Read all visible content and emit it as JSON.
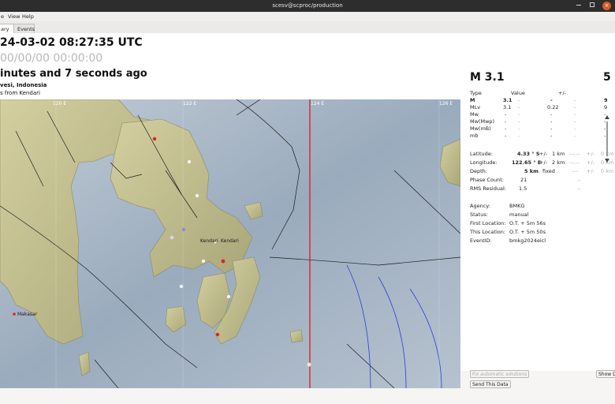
{
  "window": {
    "title": "scesv@scproc/production"
  },
  "menu": {
    "file": "e",
    "view": "View",
    "help": "Help"
  },
  "tabs": [
    {
      "label": "ary"
    },
    {
      "label": "Events"
    }
  ],
  "event": {
    "time": "24-03-02 08:27:35 UTC",
    "sub_time": "00/00/00  00:00:00",
    "ago": "inutes and 7 seconds ago",
    "region": "vesi, Indonesia",
    "distance": "s from Kendari"
  },
  "map": {
    "lon_labels": [
      "120 E",
      "122 E",
      "124 E",
      "126 E"
    ],
    "places": [
      "Kendari",
      "Kendari",
      "Makasar"
    ],
    "colors": {
      "sea": "#a8b6c5",
      "land": "#c7c48f",
      "epicenter_line": "#e01010"
    }
  },
  "magnitude": {
    "title": "M 3.1",
    "headers": {
      "type": "Type",
      "value": "Value",
      "pm": "+/-"
    },
    "rows": [
      {
        "type": "M",
        "value": "3.1",
        "c1": "-",
        "pm": "-",
        "c2": "-",
        "count": "9"
      },
      {
        "type": "MLv",
        "value": "3.1",
        "c1": "-",
        "pm": "0.22",
        "c2": "-",
        "count": "9"
      },
      {
        "type": "Mw",
        "value": "-",
        "c1": "-",
        "pm": "-",
        "c2": "-",
        "count": "-"
      },
      {
        "type": "Mw(Mwp)",
        "value": "-",
        "c1": "-",
        "pm": "-",
        "c2": "-",
        "count": "-"
      },
      {
        "type": "Mw(mB)",
        "value": "-",
        "c1": "-",
        "pm": "-",
        "c2": "-",
        "count": "-"
      },
      {
        "type": "mb",
        "value": "-",
        "c1": "-",
        "pm": "-",
        "c2": "-",
        "count": "-"
      }
    ]
  },
  "depth_title": "5 k",
  "origin": {
    "latitude": {
      "label": "Latitude:",
      "value": "4.33 ° S",
      "pm": "+/-",
      "err": "1 km",
      "extra1": "---.--",
      "pm2": "+/-",
      "err2": "0 km"
    },
    "longitude": {
      "label": "Longitude:",
      "value": "122.65 ° E",
      "pm": "+/-",
      "err": "2 km",
      "extra1": "---.--",
      "pm2": "+/-",
      "err2": "0 km"
    },
    "depth": {
      "label": "Depth:",
      "value": "5 km",
      "status": "fixed",
      "extra1": "---",
      "pm2": "+/-",
      "err2": "0 km"
    },
    "phase_count": {
      "label": "Phase Count:",
      "value": "21",
      "extra": "--"
    },
    "rms": {
      "label": "RMS Residual:",
      "value": "1.5",
      "extra": "--"
    }
  },
  "info": {
    "agency": {
      "label": "Agency:",
      "value": "BMKG"
    },
    "status": {
      "label": "Status:",
      "value": "manual"
    },
    "first": {
      "label": "First Location:",
      "value": "O.T. + 5m 56s"
    },
    "this": {
      "label": "This Location:",
      "value": "O.T. + 5m 50s"
    },
    "event_id": {
      "label": "EventID:",
      "value": "bmkg2024eicl"
    }
  },
  "buttons": {
    "fix": "Fix automatic solutions",
    "send": "Send This Data",
    "show": "Show D"
  }
}
